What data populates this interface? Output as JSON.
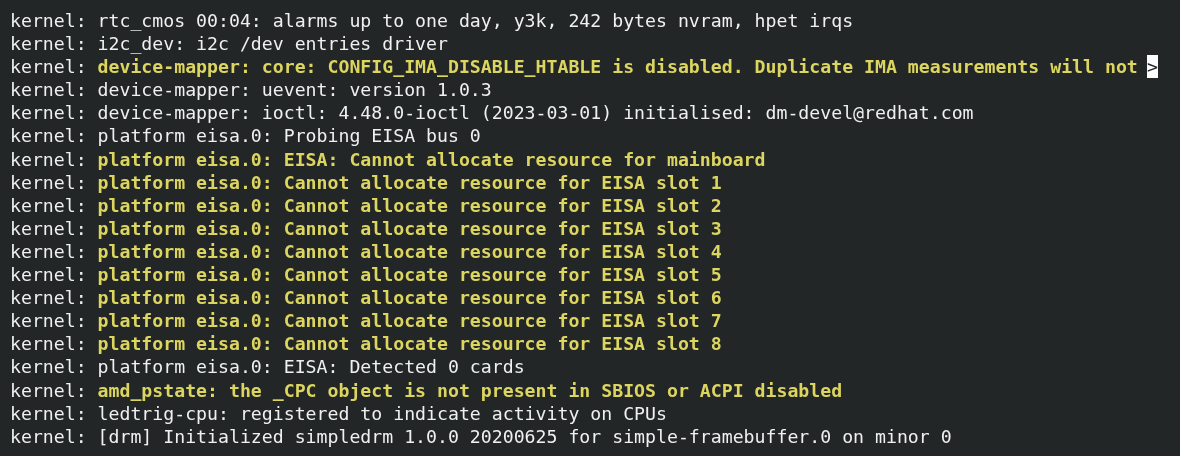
{
  "log_lines": [
    {
      "source": "kernel:",
      "message": "rtc_cmos 00:04: alarms up to one day, y3k, 242 bytes nvram, hpet irqs",
      "highlighted": false
    },
    {
      "source": "kernel:",
      "message": "i2c_dev: i2c /dev entries driver",
      "highlighted": false
    },
    {
      "source": "kernel:",
      "message": "device-mapper: core: CONFIG_IMA_DISABLE_HTABLE is disabled. Duplicate IMA measurements will not",
      "highlighted": true,
      "overflow_marker": ">"
    },
    {
      "source": "kernel:",
      "message": "device-mapper: uevent: version 1.0.3",
      "highlighted": false
    },
    {
      "source": "kernel:",
      "message": "device-mapper: ioctl: 4.48.0-ioctl (2023-03-01) initialised: dm-devel@redhat.com",
      "highlighted": false
    },
    {
      "source": "kernel:",
      "message": "platform eisa.0: Probing EISA bus 0",
      "highlighted": false
    },
    {
      "source": "kernel:",
      "message": "platform eisa.0: EISA: Cannot allocate resource for mainboard",
      "highlighted": true
    },
    {
      "source": "kernel:",
      "message": "platform eisa.0: Cannot allocate resource for EISA slot 1",
      "highlighted": true
    },
    {
      "source": "kernel:",
      "message": "platform eisa.0: Cannot allocate resource for EISA slot 2",
      "highlighted": true
    },
    {
      "source": "kernel:",
      "message": "platform eisa.0: Cannot allocate resource for EISA slot 3",
      "highlighted": true
    },
    {
      "source": "kernel:",
      "message": "platform eisa.0: Cannot allocate resource for EISA slot 4",
      "highlighted": true
    },
    {
      "source": "kernel:",
      "message": "platform eisa.0: Cannot allocate resource for EISA slot 5",
      "highlighted": true
    },
    {
      "source": "kernel:",
      "message": "platform eisa.0: Cannot allocate resource for EISA slot 6",
      "highlighted": true
    },
    {
      "source": "kernel:",
      "message": "platform eisa.0: Cannot allocate resource for EISA slot 7",
      "highlighted": true
    },
    {
      "source": "kernel:",
      "message": "platform eisa.0: Cannot allocate resource for EISA slot 8",
      "highlighted": true
    },
    {
      "source": "kernel:",
      "message": "platform eisa.0: EISA: Detected 0 cards",
      "highlighted": false
    },
    {
      "source": "kernel:",
      "message": "amd_pstate: the _CPC object is not present in SBIOS or ACPI disabled",
      "highlighted": true
    },
    {
      "source": "kernel:",
      "message": "ledtrig-cpu: registered to indicate activity on CPUs",
      "highlighted": false
    },
    {
      "source": "kernel:",
      "message": "[drm] Initialized simpledrm 1.0.0 20200625 for simple-framebuffer.0 on minor 0",
      "highlighted": false
    }
  ]
}
